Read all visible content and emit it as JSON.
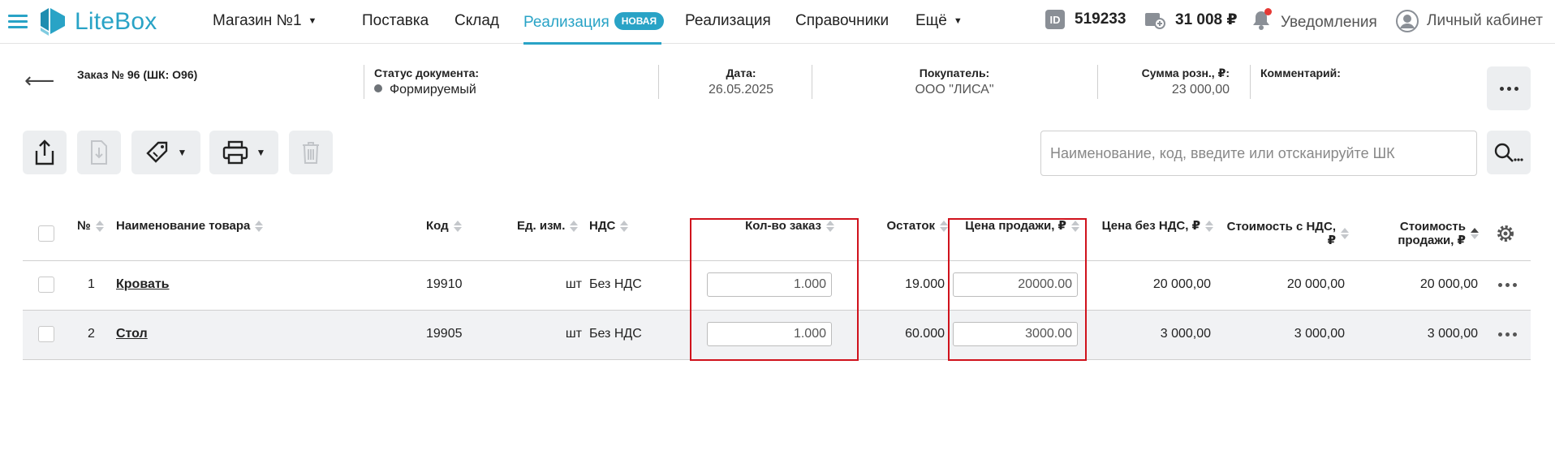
{
  "brand": {
    "name": "LiteBox",
    "color": "#29a3c6"
  },
  "topnav": {
    "store": "Магазин №1",
    "items": [
      {
        "label": "Поставка"
      },
      {
        "label": "Склад"
      },
      {
        "label": "Реализация",
        "badge": "НОВАЯ",
        "active": true
      },
      {
        "label": "Реализация"
      },
      {
        "label": "Справочники"
      },
      {
        "label": "Ещё"
      }
    ],
    "account_id": "519233",
    "balance": "31 008 ₽",
    "notifications": "Уведомления",
    "cabinet": "Личный кабинет"
  },
  "document": {
    "title": "Заказ № 96 (ШК: О96)",
    "status_label": "Статус документа:",
    "status_value": "Формируемый",
    "date_label": "Дата:",
    "date_value": "26.05.2025",
    "buyer_label": "Покупатель:",
    "buyer_value": "ООО \"ЛИСА\"",
    "sum_label": "Сумма розн., ₽:",
    "sum_value": "23 000,00",
    "comment_label": "Комментарий:"
  },
  "search": {
    "placeholder": "Наименование, код, введите или отсканируйте ШК"
  },
  "table": {
    "headers": {
      "num": "№",
      "name": "Наименование товара",
      "code": "Код",
      "unit": "Ед. изм.",
      "vat": "НДС",
      "qty": "Кол-во заказ",
      "stock": "Остаток",
      "price": "Цена продажи, ₽",
      "price_novat": "Цена без НДС, ₽",
      "cost_vat_line1": "Стоимость с НДС,",
      "cost_vat_line2": "₽",
      "cost_sale_line1": "Стоимость",
      "cost_sale_line2": "продажи, ₽"
    },
    "rows": [
      {
        "num": "1",
        "name": "Кровать",
        "code": "19910",
        "unit": "шт",
        "vat": "Без НДС",
        "qty": "1.000",
        "stock": "19.000",
        "price": "20000.00",
        "price_novat": "20 000,00",
        "cost_vat": "20 000,00",
        "cost_sale": "20 000,00"
      },
      {
        "num": "2",
        "name": "Стол",
        "code": "19905",
        "unit": "шт",
        "vat": "Без НДС",
        "qty": "1.000",
        "stock": "60.000",
        "price": "3000.00",
        "price_novat": "3 000,00",
        "cost_vat": "3 000,00",
        "cost_sale": "3 000,00"
      }
    ]
  },
  "highlight_color": "#d0121c"
}
